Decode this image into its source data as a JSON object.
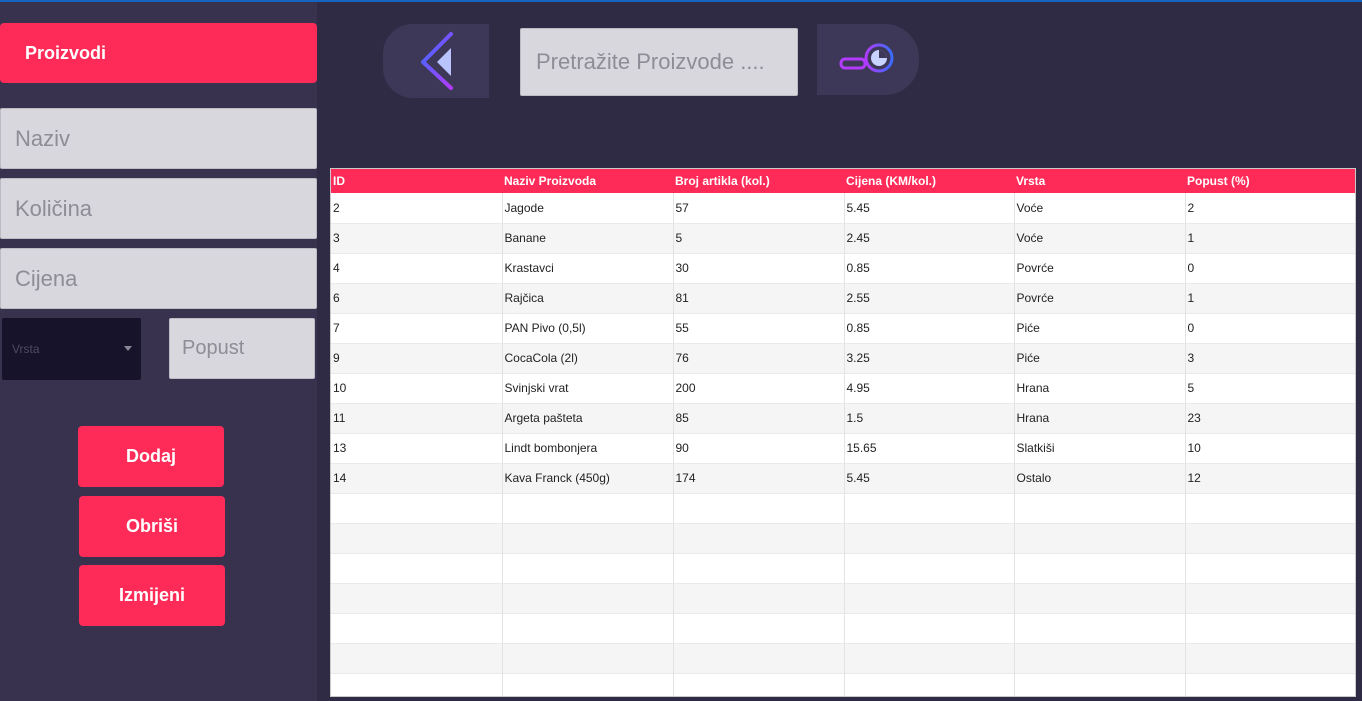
{
  "sidebar": {
    "title": "Proizvodi",
    "fields": {
      "naziv_placeholder": "Naziv",
      "kolicina_placeholder": "Količina",
      "cijena_placeholder": "Cijena",
      "vrsta_placeholder": "Vrsta",
      "popust_placeholder": "Popust"
    },
    "buttons": {
      "add": "Dodaj",
      "delete": "Obriši",
      "edit": "Izmijeni"
    }
  },
  "toolbar": {
    "back_icon": "chevron-left-icon",
    "search_placeholder": "Pretražite Proizvode ....",
    "search_icon": "search-icon"
  },
  "table": {
    "columns": [
      "ID",
      "Naziv Proizvoda",
      "Broj artikla (kol.)",
      "Cijena (KM/kol.)",
      "Vrsta",
      "Popust (%)"
    ],
    "rows": [
      [
        "2",
        "Jagode",
        "57",
        "5.45",
        "Voće",
        "2"
      ],
      [
        "3",
        "Banane",
        "5",
        "2.45",
        "Voće",
        "1"
      ],
      [
        "4",
        "Krastavci",
        "30",
        "0.85",
        "Povrće",
        "0"
      ],
      [
        "6",
        "Rajčica",
        "81",
        "2.55",
        "Povrće",
        "1"
      ],
      [
        "7",
        "PAN Pivo (0,5l)",
        "55",
        "0.85",
        "Piće",
        "0"
      ],
      [
        "9",
        "CocaCola (2l)",
        "76",
        "3.25",
        "Piće",
        "3"
      ],
      [
        "10",
        "Svinjski vrat",
        "200",
        "4.95",
        "Hrana",
        "5"
      ],
      [
        "11",
        "Argeta pašteta",
        "85",
        "1.5",
        "Hrana",
        "23"
      ],
      [
        "13",
        "Lindt bombonjera",
        "90",
        "15.65",
        "Slatkiši",
        "10"
      ],
      [
        "14",
        "Kava Franck (450g)",
        "174",
        "5.45",
        "Ostalo",
        "12"
      ]
    ]
  },
  "colors": {
    "accent": "#fe2b58",
    "sidebar_bg": "#38324f",
    "main_bg": "#2f2b45",
    "select_bg": "#16132a"
  }
}
